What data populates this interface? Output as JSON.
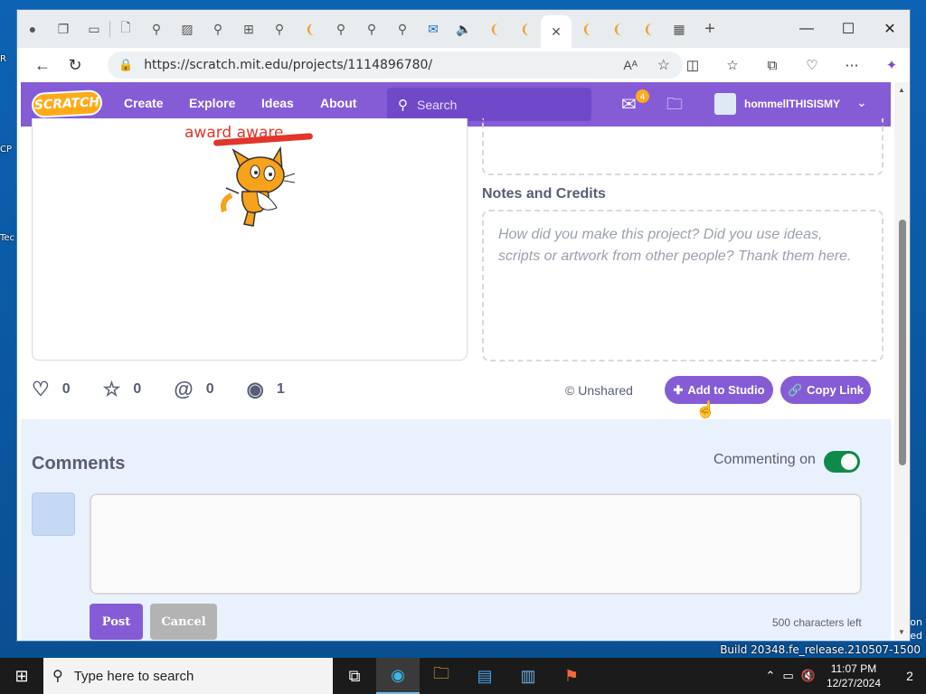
{
  "desktop": {
    "icon_labels": [
      "R",
      "CP",
      "Tec"
    ],
    "build_text": "Build 20348.fe_release.210507-1500",
    "side_text": [
      "on",
      "ed"
    ]
  },
  "browser": {
    "url": "https://scratch.mit.edu/projects/1114896780/",
    "tab_close": "✕",
    "new_tab": "+",
    "minimize": "—",
    "maximize": "☐",
    "close": "✕"
  },
  "nav": {
    "logo": "SCRATCH",
    "links": [
      "Create",
      "Explore",
      "Ideas",
      "About"
    ],
    "search_placeholder": "Search",
    "message_count": "4",
    "username": "hommellTHISISMY"
  },
  "stage": {
    "overlay_text": "award aware"
  },
  "notes": {
    "heading": "Notes and Credits",
    "placeholder": "How did you make this project? Did you use ideas, scripts or artwork from other people? Thank them here."
  },
  "stats": {
    "loves": "0",
    "favorites": "0",
    "remixes": "0",
    "views": "1"
  },
  "actions": {
    "unshared": "Unshared",
    "add_to_studio": "Add to Studio",
    "copy_link": "Copy Link"
  },
  "comments": {
    "heading": "Comments",
    "commenting_label": "Commenting on",
    "commenting_enabled": true,
    "post": "Post",
    "cancel": "Cancel",
    "chars_left": "500 characters left"
  },
  "taskbar": {
    "search_placeholder": "Type here to search",
    "time": "11:07 PM",
    "date": "12/27/2024",
    "notification_count": "2"
  },
  "colors": {
    "scratch_purple": "#855cd6",
    "toggle_on": "#0f8a4a",
    "comments_bg": "#e9f1fc"
  }
}
